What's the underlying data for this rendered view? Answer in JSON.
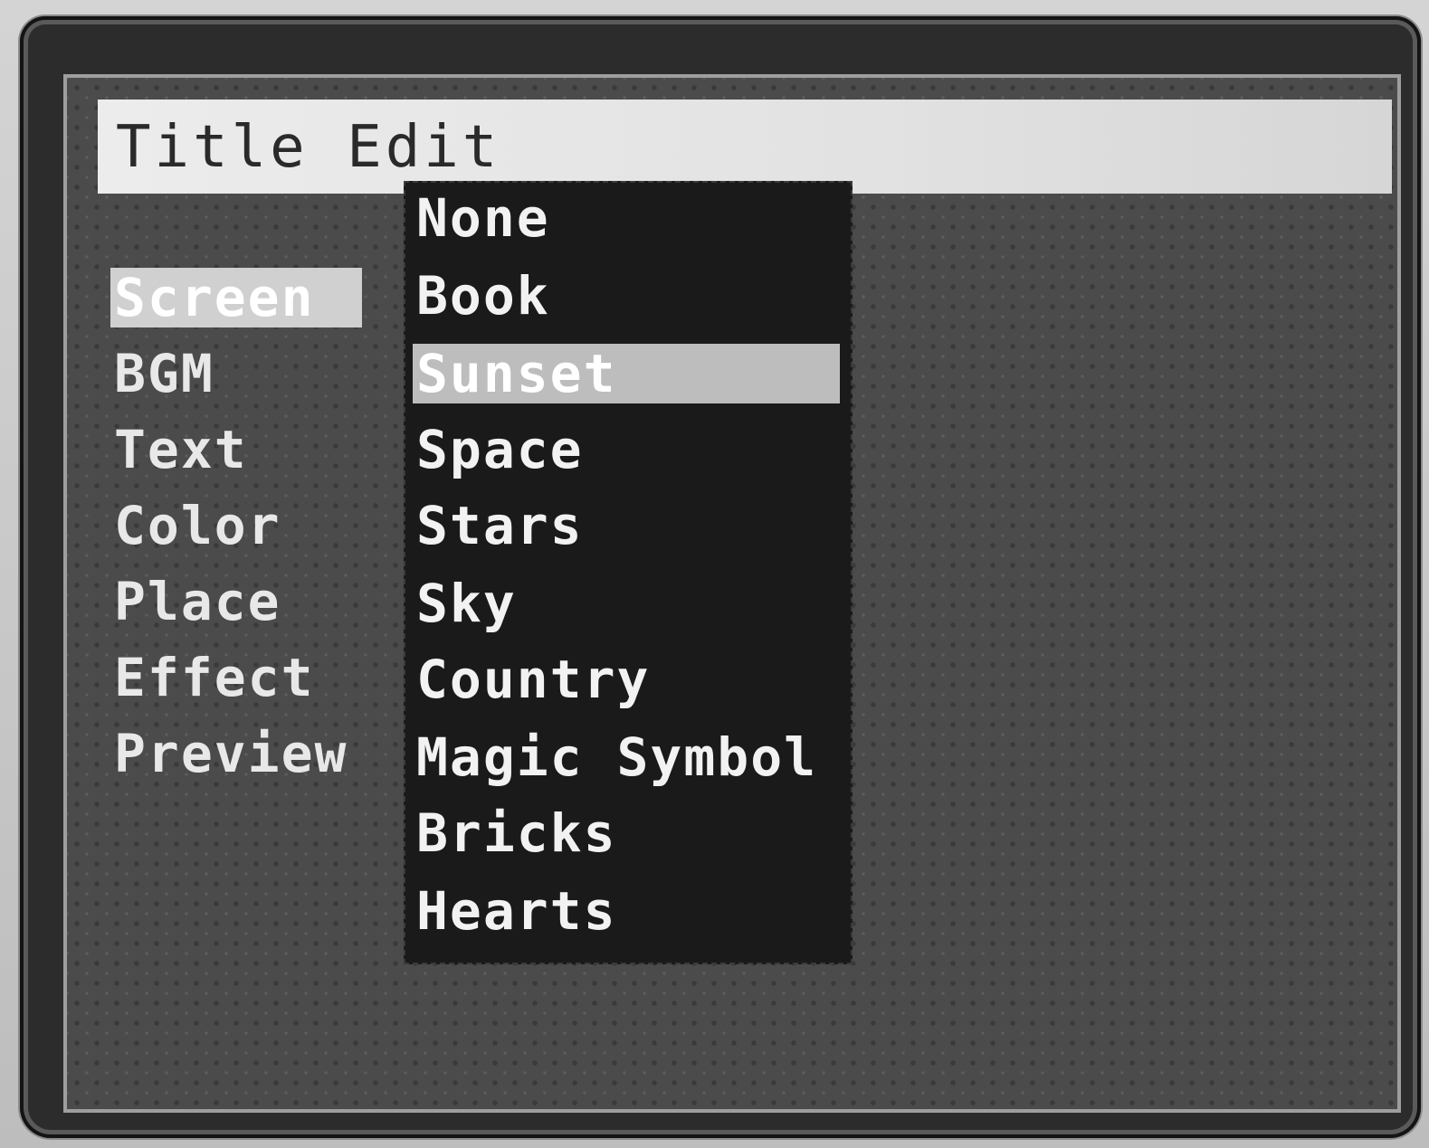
{
  "title_bar": {
    "title": "Title Edit"
  },
  "side_menu": {
    "items": [
      {
        "label": "Screen",
        "selected": true
      },
      {
        "label": "BGM",
        "selected": false
      },
      {
        "label": "Text",
        "selected": false
      },
      {
        "label": "Color",
        "selected": false
      },
      {
        "label": "Place",
        "selected": false
      },
      {
        "label": "Effect",
        "selected": false
      },
      {
        "label": "Preview",
        "selected": false
      }
    ]
  },
  "dropdown": {
    "items": [
      {
        "label": "None"
      },
      {
        "label": "Book"
      },
      {
        "label": "Sunset"
      },
      {
        "label": "Space"
      },
      {
        "label": "Stars"
      },
      {
        "label": "Sky"
      },
      {
        "label": "Country"
      },
      {
        "label": "Magic Symbol"
      },
      {
        "label": "Bricks"
      },
      {
        "label": "Hearts"
      }
    ],
    "selected_index": 2
  },
  "colors": {
    "screen_bg": "#4b4b4b",
    "dropdown_bg": "#1a1a1a",
    "highlight": "#d0d0d0",
    "title_bar": "#ececec"
  }
}
